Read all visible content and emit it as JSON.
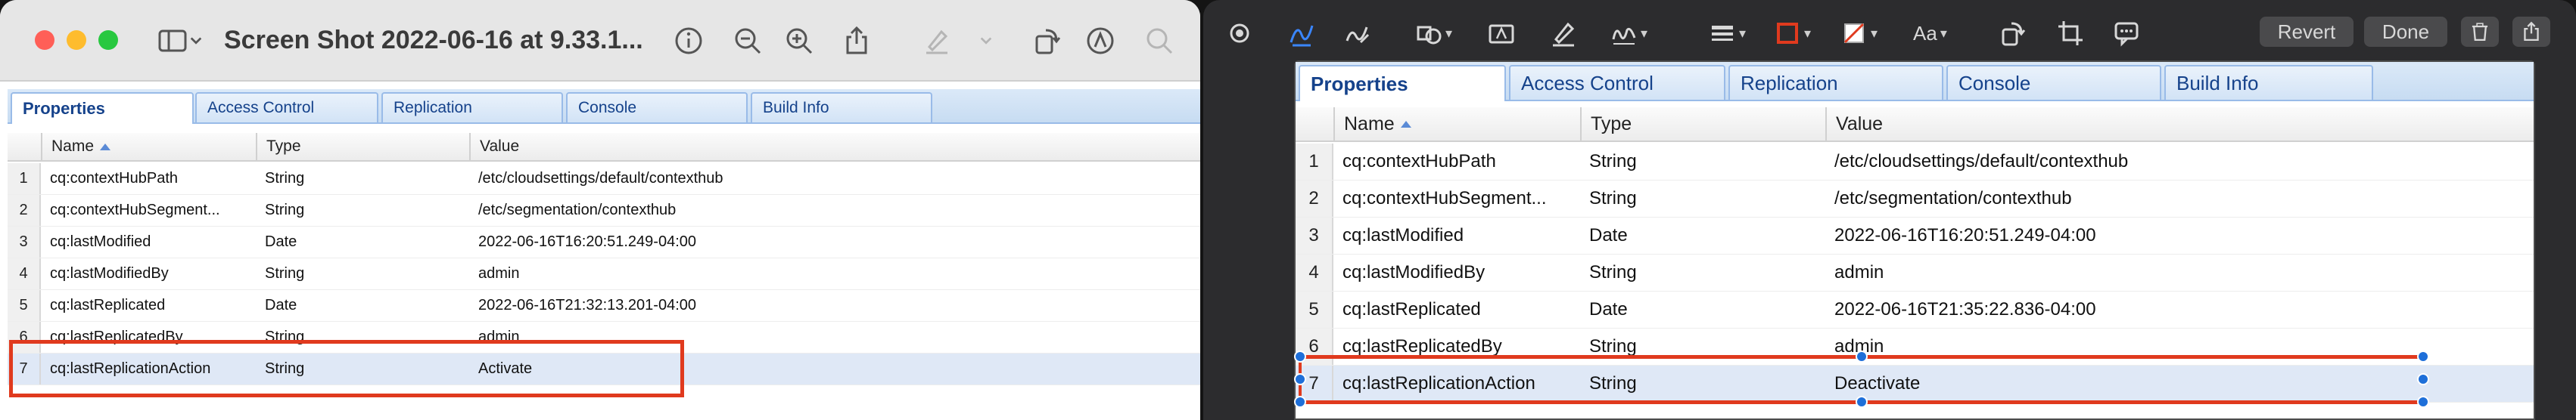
{
  "left_window": {
    "title": "Screen Shot 2022-06-16 at 9.33.1...",
    "icons": [
      "sidebar-icon",
      "chevron-down-icon",
      "info-icon",
      "zoom-out-icon",
      "zoom-in-icon",
      "share-icon",
      "highlight-icon",
      "rotate-icon",
      "markup-icon",
      "search-icon"
    ]
  },
  "right_window": {
    "buttons": {
      "revert": "Revert",
      "done": "Done"
    },
    "text_style_label": "Aa"
  },
  "tabs": [
    "Properties",
    "Access Control",
    "Replication",
    "Console",
    "Build Info"
  ],
  "columns": [
    "Name",
    "Type",
    "Value"
  ],
  "rows_left": [
    {
      "num": "1",
      "name": "cq:contextHubPath",
      "type": "String",
      "value": "/etc/cloudsettings/default/contexthub"
    },
    {
      "num": "2",
      "name": "cq:contextHubSegment...",
      "type": "String",
      "value": "/etc/segmentation/contexthub"
    },
    {
      "num": "3",
      "name": "cq:lastModified",
      "type": "Date",
      "value": "2022-06-16T16:20:51.249-04:00"
    },
    {
      "num": "4",
      "name": "cq:lastModifiedBy",
      "type": "String",
      "value": "admin"
    },
    {
      "num": "5",
      "name": "cq:lastReplicated",
      "type": "Date",
      "value": "2022-06-16T21:32:13.201-04:00"
    },
    {
      "num": "6",
      "name": "cq:lastReplicatedBy",
      "type": "String",
      "value": "admin"
    },
    {
      "num": "7",
      "name": "cq:lastReplicationAction",
      "type": "String",
      "value": "Activate"
    }
  ],
  "rows_right": [
    {
      "num": "1",
      "name": "cq:contextHubPath",
      "type": "String",
      "value": "/etc/cloudsettings/default/contexthub"
    },
    {
      "num": "2",
      "name": "cq:contextHubSegment...",
      "type": "String",
      "value": "/etc/segmentation/contexthub"
    },
    {
      "num": "3",
      "name": "cq:lastModified",
      "type": "Date",
      "value": "2022-06-16T16:20:51.249-04:00"
    },
    {
      "num": "4",
      "name": "cq:lastModifiedBy",
      "type": "String",
      "value": "admin"
    },
    {
      "num": "5",
      "name": "cq:lastReplicated",
      "type": "Date",
      "value": "2022-06-16T21:35:22.836-04:00"
    },
    {
      "num": "6",
      "name": "cq:lastReplicatedBy",
      "type": "String",
      "value": "admin"
    },
    {
      "num": "7",
      "name": "cq:lastReplicationAction",
      "type": "String",
      "value": "Deactivate"
    }
  ],
  "colors": {
    "annotation_red": "#e03a1e",
    "handle_blue": "#1e6fd9",
    "tab_text": "#15428b",
    "selected_row": "#dfe8f6"
  }
}
